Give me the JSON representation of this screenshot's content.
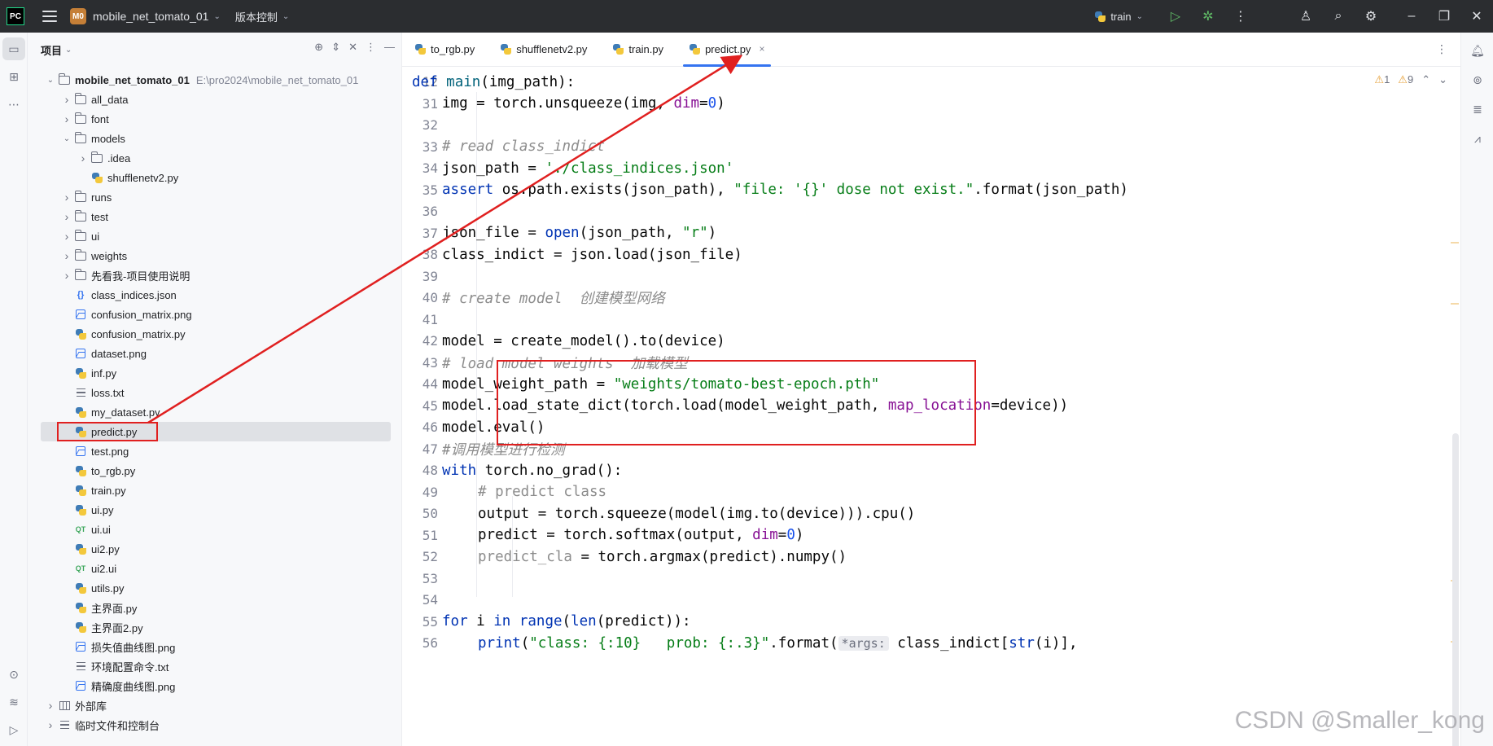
{
  "titlebar": {
    "logo": "PC",
    "project_badge": "M0",
    "project_name": "mobile_net_tomato_01",
    "vcs_label": "版本控制",
    "run_config": "train",
    "icons": [
      "hamburger-menu-icon",
      "run-icon",
      "debug-icon",
      "more-icon",
      "add-user-icon",
      "search-icon",
      "settings-icon",
      "minimize-icon",
      "restore-icon",
      "close-icon"
    ]
  },
  "left_strip": {
    "icons": [
      "project-icon",
      "structure-icon",
      "more-icon",
      "python-console-icon",
      "layers-icon",
      "run-icon"
    ]
  },
  "project_panel": {
    "title": "项目",
    "tools": [
      "locate-icon",
      "expand-icon",
      "collapse-icon",
      "options-icon",
      "hide-icon"
    ],
    "tree": [
      {
        "label": "mobile_net_tomato_01",
        "path": "E:\\pro2024\\mobile_net_tomato_01",
        "type": "folder",
        "depth": 0,
        "arrow": "open",
        "bold": true
      },
      {
        "label": "all_data",
        "type": "folder",
        "depth": 1,
        "arrow": "closed"
      },
      {
        "label": "font",
        "type": "folder",
        "depth": 1,
        "arrow": "closed"
      },
      {
        "label": "models",
        "type": "folder",
        "depth": 1,
        "arrow": "open"
      },
      {
        "label": ".idea",
        "type": "folder",
        "depth": 2,
        "arrow": "closed"
      },
      {
        "label": "shufflenetv2.py",
        "type": "py",
        "depth": 2,
        "arrow": "none"
      },
      {
        "label": "runs",
        "type": "folder",
        "depth": 1,
        "arrow": "closed"
      },
      {
        "label": "test",
        "type": "folder",
        "depth": 1,
        "arrow": "closed"
      },
      {
        "label": "ui",
        "type": "folder",
        "depth": 1,
        "arrow": "closed"
      },
      {
        "label": "weights",
        "type": "folder",
        "depth": 1,
        "arrow": "closed"
      },
      {
        "label": "先看我-项目使用说明",
        "type": "folder",
        "depth": 1,
        "arrow": "closed"
      },
      {
        "label": "class_indices.json",
        "type": "json",
        "depth": 1,
        "arrow": "none"
      },
      {
        "label": "confusion_matrix.png",
        "type": "img",
        "depth": 1,
        "arrow": "none"
      },
      {
        "label": "confusion_matrix.py",
        "type": "py",
        "depth": 1,
        "arrow": "none"
      },
      {
        "label": "dataset.png",
        "type": "img",
        "depth": 1,
        "arrow": "none"
      },
      {
        "label": "inf.py",
        "type": "py",
        "depth": 1,
        "arrow": "none"
      },
      {
        "label": "loss.txt",
        "type": "txt",
        "depth": 1,
        "arrow": "none"
      },
      {
        "label": "my_dataset.py",
        "type": "py",
        "depth": 1,
        "arrow": "none"
      },
      {
        "label": "predict.py",
        "type": "py",
        "depth": 1,
        "arrow": "none",
        "selected": true
      },
      {
        "label": "test.png",
        "type": "img",
        "depth": 1,
        "arrow": "none"
      },
      {
        "label": "to_rgb.py",
        "type": "py",
        "depth": 1,
        "arrow": "none"
      },
      {
        "label": "train.py",
        "type": "py",
        "depth": 1,
        "arrow": "none"
      },
      {
        "label": "ui.py",
        "type": "py",
        "depth": 1,
        "arrow": "none"
      },
      {
        "label": "ui.ui",
        "type": "qt",
        "depth": 1,
        "arrow": "none"
      },
      {
        "label": "ui2.py",
        "type": "py",
        "depth": 1,
        "arrow": "none"
      },
      {
        "label": "ui2.ui",
        "type": "qt",
        "depth": 1,
        "arrow": "none"
      },
      {
        "label": "utils.py",
        "type": "py",
        "depth": 1,
        "arrow": "none"
      },
      {
        "label": "主界面.py",
        "type": "py",
        "depth": 1,
        "arrow": "none"
      },
      {
        "label": "主界面2.py",
        "type": "py",
        "depth": 1,
        "arrow": "none"
      },
      {
        "label": "损失值曲线图.png",
        "type": "img",
        "depth": 1,
        "arrow": "none"
      },
      {
        "label": "环境配置命令.txt",
        "type": "txt",
        "depth": 1,
        "arrow": "none"
      },
      {
        "label": "精确度曲线图.png",
        "type": "img",
        "depth": 1,
        "arrow": "none"
      },
      {
        "label": "外部库",
        "type": "lib",
        "depth": 0,
        "arrow": "closed"
      },
      {
        "label": "临时文件和控制台",
        "type": "scratch",
        "depth": 0,
        "arrow": "closed"
      }
    ]
  },
  "editor": {
    "tabs": [
      {
        "label": "to_rgb.py",
        "active": false
      },
      {
        "label": "shufflenetv2.py",
        "active": false
      },
      {
        "label": "train.py",
        "active": false
      },
      {
        "label": "predict.py",
        "active": true
      }
    ],
    "close_glyph": "×",
    "inspections": {
      "warnings": "1",
      "weak_warnings": "9"
    },
    "lines": [
      {
        "n": "12",
        "indent": 0,
        "tokens": [
          {
            "t": "def ",
            "c": "kw"
          },
          {
            "t": "main",
            "c": "fn"
          },
          {
            "t": "(img_path):",
            "c": ""
          }
        ]
      },
      {
        "n": "31",
        "indent": 1,
        "tokens": [
          {
            "t": "img = torch.unsqueeze(img, ",
            "c": ""
          },
          {
            "t": "dim",
            "c": "prm"
          },
          {
            "t": "=",
            "c": ""
          },
          {
            "t": "0",
            "c": "num"
          },
          {
            "t": ")",
            "c": ""
          }
        ]
      },
      {
        "n": "32",
        "indent": 0,
        "tokens": []
      },
      {
        "n": "33",
        "indent": 1,
        "tokens": [
          {
            "t": "# read class_indict",
            "c": "cmt"
          }
        ]
      },
      {
        "n": "34",
        "indent": 1,
        "tokens": [
          {
            "t": "json_path = ",
            "c": ""
          },
          {
            "t": "'./class_indices.json'",
            "c": "str"
          }
        ]
      },
      {
        "n": "35",
        "indent": 1,
        "tokens": [
          {
            "t": "assert ",
            "c": "kw"
          },
          {
            "t": "os.path.exists(json_path), ",
            "c": ""
          },
          {
            "t": "\"file: '{}' dose not exist.\"",
            "c": "str"
          },
          {
            "t": ".format(json_path)",
            "c": ""
          }
        ]
      },
      {
        "n": "36",
        "indent": 0,
        "tokens": []
      },
      {
        "n": "37",
        "indent": 1,
        "tokens": [
          {
            "t": "json_file = ",
            "c": ""
          },
          {
            "t": "open",
            "c": "kw"
          },
          {
            "t": "(json_path, ",
            "c": ""
          },
          {
            "t": "\"r\"",
            "c": "str"
          },
          {
            "t": ")",
            "c": ""
          }
        ]
      },
      {
        "n": "38",
        "indent": 1,
        "tokens": [
          {
            "t": "class_indict = json.load(json_file)",
            "c": ""
          }
        ]
      },
      {
        "n": "39",
        "indent": 0,
        "tokens": []
      },
      {
        "n": "40",
        "indent": 1,
        "tokens": [
          {
            "t": "# create model  创建模型网络",
            "c": "cmt"
          }
        ]
      },
      {
        "n": "41",
        "indent": 0,
        "tokens": []
      },
      {
        "n": "42",
        "indent": 1,
        "tokens": [
          {
            "t": "model = create_model().to(device)",
            "c": ""
          }
        ]
      },
      {
        "n": "43",
        "indent": 1,
        "tokens": [
          {
            "t": "# load model weights  加载模型",
            "c": "cmt"
          }
        ]
      },
      {
        "n": "44",
        "indent": 1,
        "tokens": [
          {
            "t": "model_weight_path = ",
            "c": ""
          },
          {
            "t": "\"weights/tomato-best-epoch.pth\"",
            "c": "str"
          }
        ]
      },
      {
        "n": "45",
        "indent": 1,
        "tokens": [
          {
            "t": "model.load_state_dict(torch.load(model_weight_path, ",
            "c": ""
          },
          {
            "t": "map_location",
            "c": "prm"
          },
          {
            "t": "=device))",
            "c": ""
          }
        ]
      },
      {
        "n": "46",
        "indent": 1,
        "tokens": [
          {
            "t": "model.eval()",
            "c": ""
          }
        ]
      },
      {
        "n": "47",
        "indent": 1,
        "tokens": [
          {
            "t": "#调用模型进行检测",
            "c": "cmt"
          }
        ]
      },
      {
        "n": "48",
        "indent": 1,
        "tokens": [
          {
            "t": "with ",
            "c": "kw"
          },
          {
            "t": "torch.no_grad():",
            "c": ""
          }
        ]
      },
      {
        "n": "49",
        "indent": 2,
        "tokens": [
          {
            "t": "# predict class",
            "c": "cmt-dim"
          }
        ]
      },
      {
        "n": "50",
        "indent": 2,
        "tokens": [
          {
            "t": "output = torch.squeeze(model(img.to(device))).cpu()",
            "c": ""
          }
        ]
      },
      {
        "n": "51",
        "indent": 2,
        "tokens": [
          {
            "t": "predict = torch.softmax(output, ",
            "c": ""
          },
          {
            "t": "dim",
            "c": "prm"
          },
          {
            "t": "=",
            "c": ""
          },
          {
            "t": "0",
            "c": "num"
          },
          {
            "t": ")",
            "c": ""
          }
        ]
      },
      {
        "n": "52",
        "indent": 2,
        "tokens": [
          {
            "t": "predict_cla",
            "c": "cmt-dim"
          },
          {
            "t": " = torch.argmax(predict).numpy()",
            "c": ""
          }
        ]
      },
      {
        "n": "53",
        "indent": 0,
        "tokens": []
      },
      {
        "n": "54",
        "indent": 0,
        "tokens": []
      },
      {
        "n": "55",
        "indent": 1,
        "tokens": [
          {
            "t": "for ",
            "c": "kw"
          },
          {
            "t": "i ",
            "c": ""
          },
          {
            "t": "in ",
            "c": "kw"
          },
          {
            "t": "range",
            "c": "kw"
          },
          {
            "t": "(",
            "c": ""
          },
          {
            "t": "len",
            "c": "kw"
          },
          {
            "t": "(predict)):",
            "c": ""
          }
        ]
      },
      {
        "n": "56",
        "indent": 2,
        "tokens": [
          {
            "t": "print",
            "c": "kw"
          },
          {
            "t": "(",
            "c": ""
          },
          {
            "t": "\"class: {:10}   prob: {:.3}\"",
            "c": "str"
          },
          {
            "t": ".format(",
            "c": ""
          },
          {
            "t": "*args:",
            "c": "hint"
          },
          {
            "t": " class_indict[",
            "c": ""
          },
          {
            "t": "str",
            "c": "kw"
          },
          {
            "t": "(i)],",
            "c": ""
          }
        ]
      }
    ]
  },
  "right_strip": {
    "icons": [
      "notifications-icon",
      "ai-assistant-icon",
      "database-icon",
      "sciview-icon"
    ]
  },
  "watermark": "CSDN @Smaller_kong",
  "annotation_color": "#e02020"
}
